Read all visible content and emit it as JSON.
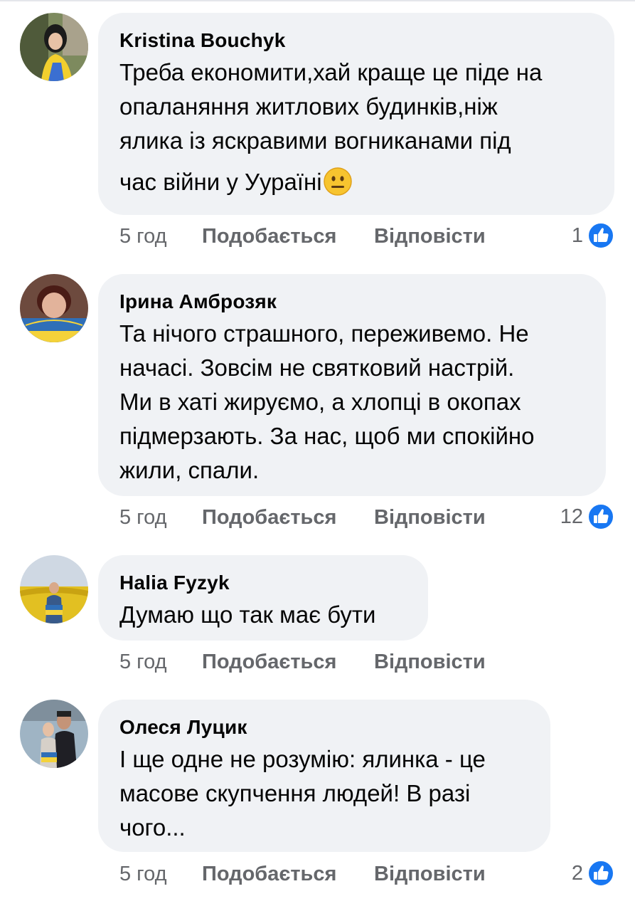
{
  "comments": [
    {
      "author": "Kristina Bouchyk",
      "lines": [
        "Треба економити,хай краще це піде на",
        "опаланяння житлових будинків,ніж",
        "ялика із яскравими вогниканами під",
        "час війни у Уураїні"
      ],
      "emoji": "neutral-face-emoji",
      "time": "5 год",
      "like_label": "Подобається",
      "reply_label": "Відповісти",
      "reaction_count": "1"
    },
    {
      "author": "Ірина Амброзяк",
      "lines": [
        "Та нічого страшного, переживемо. Не",
        "начасі. Зовсім не святковий настрій.",
        "Ми в хаті жируємо, а хлопці в окопах",
        "підмерзають. За нас, щоб ми спокійно",
        "жили, спали."
      ],
      "time": "5 год",
      "like_label": "Подобається",
      "reply_label": "Відповісти",
      "reaction_count": "12"
    },
    {
      "author": "Halia Fyzyk",
      "lines": [
        "Думаю що так має бути"
      ],
      "time": "5 год",
      "like_label": "Подобається",
      "reply_label": "Відповісти",
      "reaction_count": ""
    },
    {
      "author": "Олеся Луцик",
      "lines": [
        "І ще одне не розумію: ялинка - це",
        "масове скупчення людей! В разі",
        "чого..."
      ],
      "time": "5 год",
      "like_label": "Подобається",
      "reply_label": "Відповісти",
      "reaction_count": "2"
    }
  ],
  "colors": {
    "bubble": "#f0f2f5",
    "meta_text": "#65676b",
    "like_blue": "#1877f2"
  }
}
